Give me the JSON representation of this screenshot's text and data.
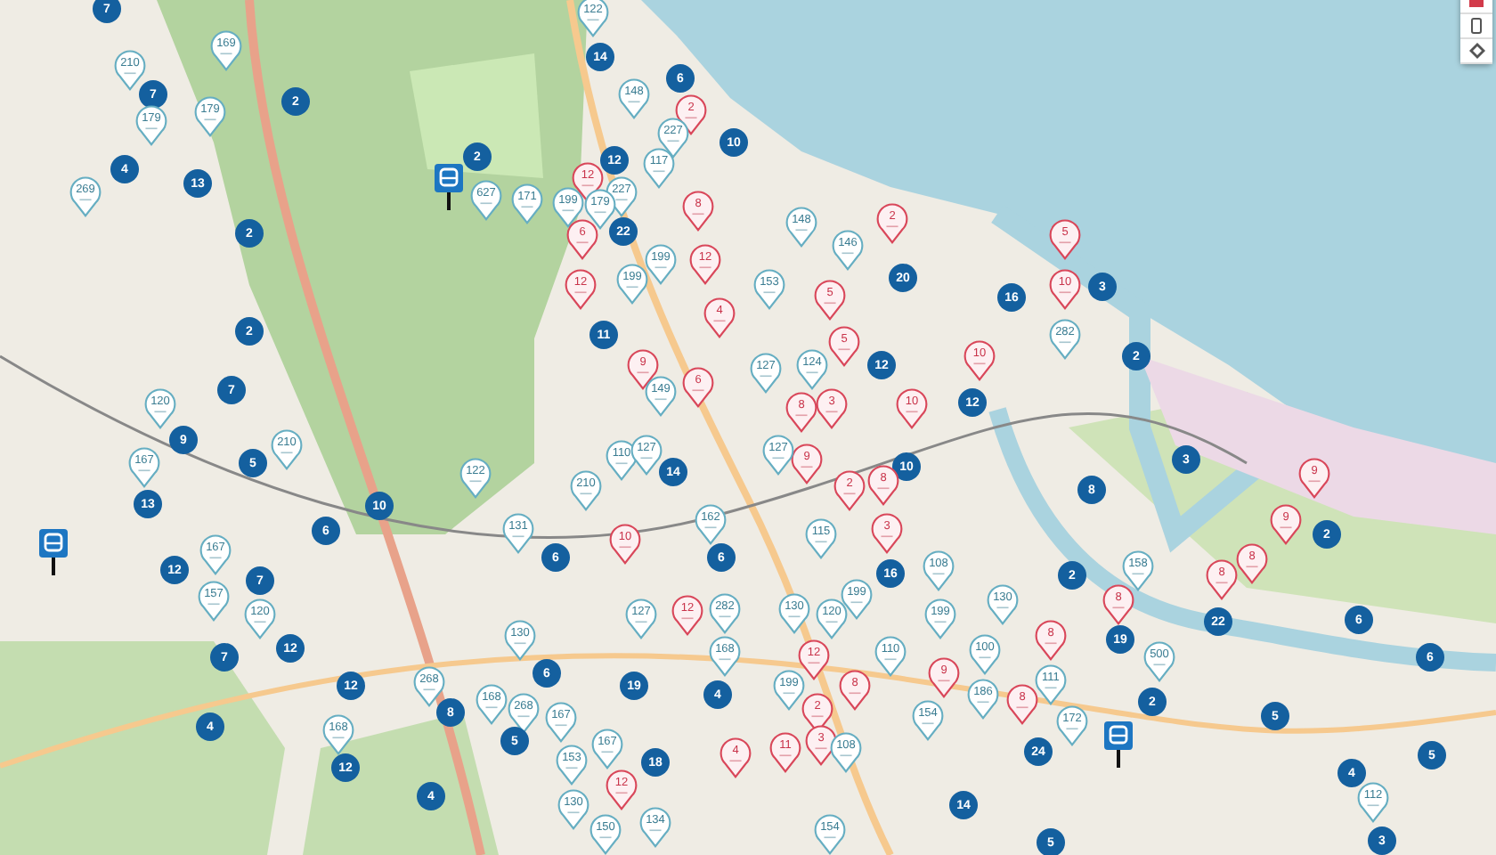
{
  "markers": [
    {
      "kind": "cluster",
      "label": "7"
    },
    {
      "kind": "pin",
      "label": "210"
    },
    {
      "kind": "pin",
      "label": "169"
    },
    {
      "kind": "cluster",
      "label": "7"
    },
    {
      "kind": "pin",
      "label": "179"
    },
    {
      "kind": "pin",
      "label": "179"
    },
    {
      "kind": "cluster",
      "label": "2"
    },
    {
      "kind": "cluster",
      "label": "4"
    },
    {
      "kind": "pin",
      "label": "269"
    },
    {
      "kind": "cluster",
      "label": "13"
    },
    {
      "kind": "cluster",
      "label": "2"
    },
    {
      "kind": "cluster",
      "label": "2"
    },
    {
      "kind": "bus"
    },
    {
      "kind": "pin",
      "label": "627"
    },
    {
      "kind": "pin",
      "label": "171"
    },
    {
      "kind": "pin",
      "label": "199"
    },
    {
      "kind": "cluster",
      "label": "2"
    },
    {
      "kind": "cluster",
      "label": "7"
    },
    {
      "kind": "pin",
      "label": "120"
    },
    {
      "kind": "pin",
      "label": "122"
    },
    {
      "kind": "cluster",
      "label": "14"
    },
    {
      "kind": "cluster",
      "label": "6"
    },
    {
      "kind": "pin",
      "label": "148"
    },
    {
      "kind": "alert",
      "label": "2"
    },
    {
      "kind": "pin",
      "label": "227"
    },
    {
      "kind": "cluster",
      "label": "10"
    },
    {
      "kind": "cluster",
      "label": "12"
    },
    {
      "kind": "pin",
      "label": "117"
    },
    {
      "kind": "alert",
      "label": "12"
    },
    {
      "kind": "pin",
      "label": "227"
    },
    {
      "kind": "pin",
      "label": "179"
    },
    {
      "kind": "cluster",
      "label": "22"
    },
    {
      "kind": "alert",
      "label": "8"
    },
    {
      "kind": "alert",
      "label": "6"
    },
    {
      "kind": "pin",
      "label": "199"
    },
    {
      "kind": "alert",
      "label": "12"
    },
    {
      "kind": "alert",
      "label": "12"
    },
    {
      "kind": "pin",
      "label": "199"
    },
    {
      "kind": "alert",
      "label": "4"
    },
    {
      "kind": "cluster",
      "label": "11"
    },
    {
      "kind": "alert",
      "label": "9"
    },
    {
      "kind": "alert",
      "label": "6"
    },
    {
      "kind": "pin",
      "label": "149"
    },
    {
      "kind": "pin",
      "label": "148"
    },
    {
      "kind": "alert",
      "label": "2"
    },
    {
      "kind": "pin",
      "label": "146"
    },
    {
      "kind": "alert",
      "label": "5"
    },
    {
      "kind": "cluster",
      "label": "20"
    },
    {
      "kind": "pin",
      "label": "153"
    },
    {
      "kind": "cluster",
      "label": "16"
    },
    {
      "kind": "alert",
      "label": "5"
    },
    {
      "kind": "alert",
      "label": "10"
    },
    {
      "kind": "pin",
      "label": "282"
    },
    {
      "kind": "cluster",
      "label": "3"
    },
    {
      "kind": "cluster",
      "label": "2"
    },
    {
      "kind": "cluster",
      "label": "12"
    },
    {
      "kind": "alert",
      "label": "10"
    },
    {
      "kind": "cluster",
      "label": "12"
    },
    {
      "kind": "alert",
      "label": "5"
    },
    {
      "kind": "pin",
      "label": "124"
    },
    {
      "kind": "pin",
      "label": "127"
    },
    {
      "kind": "alert",
      "label": "8"
    },
    {
      "kind": "alert",
      "label": "3"
    },
    {
      "kind": "alert",
      "label": "10"
    },
    {
      "kind": "cluster",
      "label": "9"
    },
    {
      "kind": "cluster",
      "label": "5"
    },
    {
      "kind": "pin",
      "label": "210"
    },
    {
      "kind": "pin",
      "label": "167"
    },
    {
      "kind": "cluster",
      "label": "13"
    },
    {
      "kind": "cluster",
      "label": "10"
    },
    {
      "kind": "cluster",
      "label": "6"
    },
    {
      "kind": "pin",
      "label": "122"
    },
    {
      "kind": "bus"
    },
    {
      "kind": "cluster",
      "label": "12"
    },
    {
      "kind": "pin",
      "label": "167"
    },
    {
      "kind": "cluster",
      "label": "7"
    },
    {
      "kind": "pin",
      "label": "157"
    },
    {
      "kind": "pin",
      "label": "120"
    },
    {
      "kind": "cluster",
      "label": "12"
    },
    {
      "kind": "cluster",
      "label": "7"
    },
    {
      "kind": "pin",
      "label": "131"
    },
    {
      "kind": "cluster",
      "label": "6"
    },
    {
      "kind": "pin",
      "label": "130"
    },
    {
      "kind": "pin",
      "label": "210"
    },
    {
      "kind": "pin",
      "label": "110"
    },
    {
      "kind": "pin",
      "label": "127"
    },
    {
      "kind": "cluster",
      "label": "14"
    },
    {
      "kind": "pin",
      "label": "162"
    },
    {
      "kind": "cluster",
      "label": "6"
    },
    {
      "kind": "alert",
      "label": "10"
    },
    {
      "kind": "alert",
      "label": "12"
    },
    {
      "kind": "pin",
      "label": "127"
    },
    {
      "kind": "pin",
      "label": "282"
    },
    {
      "kind": "pin",
      "label": "268"
    },
    {
      "kind": "cluster",
      "label": "12"
    },
    {
      "kind": "cluster",
      "label": "4"
    },
    {
      "kind": "cluster",
      "label": "8"
    },
    {
      "kind": "pin",
      "label": "168"
    },
    {
      "kind": "cluster",
      "label": "6"
    },
    {
      "kind": "pin",
      "label": "268"
    },
    {
      "kind": "cluster",
      "label": "5"
    },
    {
      "kind": "pin",
      "label": "167"
    },
    {
      "kind": "pin",
      "label": "153"
    },
    {
      "kind": "cluster",
      "label": "19"
    },
    {
      "kind": "pin",
      "label": "168"
    },
    {
      "kind": "cluster",
      "label": "4"
    },
    {
      "kind": "pin",
      "label": "168"
    },
    {
      "kind": "cluster",
      "label": "12"
    },
    {
      "kind": "pin",
      "label": "167"
    },
    {
      "kind": "cluster",
      "label": "18"
    },
    {
      "kind": "cluster",
      "label": "4"
    },
    {
      "kind": "alert",
      "label": "4"
    },
    {
      "kind": "pin",
      "label": "130"
    },
    {
      "kind": "alert",
      "label": "12"
    },
    {
      "kind": "pin",
      "label": "150"
    },
    {
      "kind": "pin",
      "label": "134"
    },
    {
      "kind": "cluster",
      "label": "10"
    },
    {
      "kind": "alert",
      "label": "9"
    },
    {
      "kind": "pin",
      "label": "127"
    },
    {
      "kind": "alert",
      "label": "2"
    },
    {
      "kind": "alert",
      "label": "8"
    },
    {
      "kind": "pin",
      "label": "115"
    },
    {
      "kind": "alert",
      "label": "3"
    },
    {
      "kind": "cluster",
      "label": "16"
    },
    {
      "kind": "cluster",
      "label": "3"
    },
    {
      "kind": "cluster",
      "label": "8"
    },
    {
      "kind": "alert",
      "label": "9"
    },
    {
      "kind": "alert",
      "label": "9"
    },
    {
      "kind": "cluster",
      "label": "2"
    },
    {
      "kind": "pin",
      "label": "108"
    },
    {
      "kind": "cluster",
      "label": "2"
    },
    {
      "kind": "pin",
      "label": "158"
    },
    {
      "kind": "alert",
      "label": "8"
    },
    {
      "kind": "alert",
      "label": "8"
    },
    {
      "kind": "alert",
      "label": "8"
    },
    {
      "kind": "pin",
      "label": "199"
    },
    {
      "kind": "pin",
      "label": "130"
    },
    {
      "kind": "pin",
      "label": "199"
    },
    {
      "kind": "pin",
      "label": "130"
    },
    {
      "kind": "pin",
      "label": "120"
    },
    {
      "kind": "cluster",
      "label": "22"
    },
    {
      "kind": "cluster",
      "label": "6"
    },
    {
      "kind": "cluster",
      "label": "19"
    },
    {
      "kind": "alert",
      "label": "8"
    },
    {
      "kind": "pin",
      "label": "110"
    },
    {
      "kind": "pin",
      "label": "100"
    },
    {
      "kind": "pin",
      "label": "111"
    },
    {
      "kind": "pin",
      "label": "500"
    },
    {
      "kind": "cluster",
      "label": "6"
    },
    {
      "kind": "alert",
      "label": "12"
    },
    {
      "kind": "alert",
      "label": "9"
    },
    {
      "kind": "pin",
      "label": "199"
    },
    {
      "kind": "pin",
      "label": "186"
    },
    {
      "kind": "alert",
      "label": "8"
    },
    {
      "kind": "alert",
      "label": "2"
    },
    {
      "kind": "pin",
      "label": "154"
    },
    {
      "kind": "alert",
      "label": "8"
    },
    {
      "kind": "pin",
      "label": "172"
    },
    {
      "kind": "cluster",
      "label": "2"
    },
    {
      "kind": "cluster",
      "label": "5"
    },
    {
      "kind": "bus"
    },
    {
      "kind": "alert",
      "label": "11"
    },
    {
      "kind": "alert",
      "label": "3"
    },
    {
      "kind": "pin",
      "label": "108"
    },
    {
      "kind": "cluster",
      "label": "24"
    },
    {
      "kind": "cluster",
      "label": "5"
    },
    {
      "kind": "cluster",
      "label": "4"
    },
    {
      "kind": "cluster",
      "label": "14"
    },
    {
      "kind": "pin",
      "label": "112"
    },
    {
      "kind": "pin",
      "label": "154"
    },
    {
      "kind": "cluster",
      "label": "5"
    },
    {
      "kind": "cluster",
      "label": "3"
    }
  ]
}
